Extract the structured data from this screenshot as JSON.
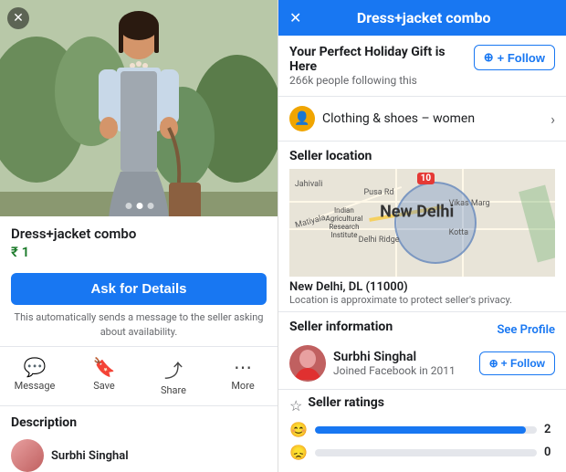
{
  "left": {
    "close_icon": "✕",
    "product_title": "Dress+jacket combo",
    "product_price": "₹ 1",
    "ask_button_label": "Ask for Details",
    "ask_subtext": "This automatically sends a message to the seller asking about availability.",
    "actions": [
      {
        "id": "message",
        "icon": "💬",
        "label": "Message"
      },
      {
        "id": "save",
        "icon": "🔖",
        "label": "Save"
      },
      {
        "id": "share",
        "icon": "↗",
        "label": "Share"
      },
      {
        "id": "more",
        "icon": "···",
        "label": "More"
      }
    ],
    "description_title": "Description",
    "seller_name": "Surbhi Singhal",
    "image_dots": [
      false,
      true,
      false
    ]
  },
  "right": {
    "header_title": "Dress+jacket combo",
    "close_icon": "✕",
    "banner_title": "Your Perfect Holiday Gift is Here",
    "banner_followers": "266k people following this",
    "follow_label": "+ Follow",
    "category_label": "Clothing & shoes – women",
    "seller_location_title": "Seller location",
    "location_city": "New Delhi, DL (11000)",
    "location_note": "Location is approximate to protect seller's privacy.",
    "map_label": "New Delhi",
    "map_pin": "10",
    "seller_info_title": "Seller information",
    "see_profile": "See Profile",
    "seller_name": "Surbhi Singhal",
    "seller_joined": "Joined Facebook in 2011",
    "follow_label2": "+ Follow",
    "ratings_title": "Seller ratings",
    "ratings": [
      {
        "type": "happy",
        "bar_pct": 95,
        "count": "2"
      },
      {
        "type": "sad",
        "bar_pct": 0,
        "count": "0"
      }
    ]
  }
}
